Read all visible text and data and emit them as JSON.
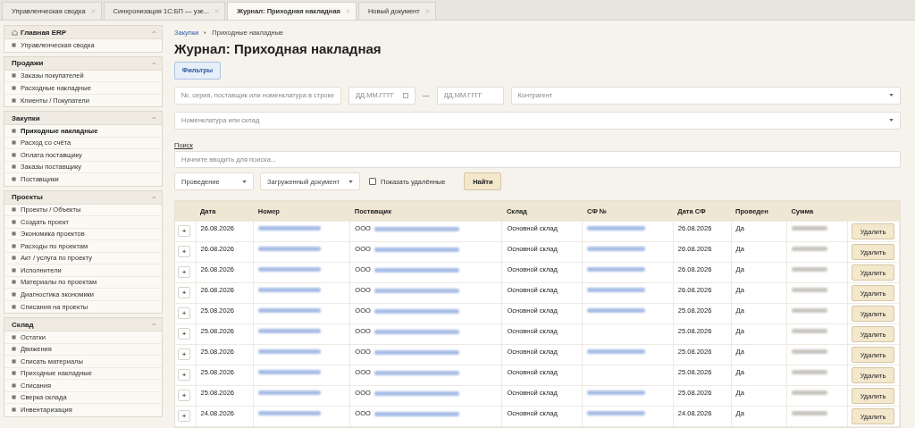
{
  "tabs": [
    {
      "label": "Управленческая сводка",
      "selected": false
    },
    {
      "label": "Синхронизация 1С:БП — узе...",
      "selected": false
    },
    {
      "label": "Журнал: Приходная накладная",
      "selected": true
    },
    {
      "label": "Новый документ",
      "selected": false
    }
  ],
  "sidebar": {
    "groups": [
      {
        "title": "Главная ERP",
        "expanded": true,
        "items": [
          {
            "label": "Управленческая сводка",
            "selected": false
          }
        ]
      },
      {
        "title": "Продажи",
        "expanded": true,
        "items": [
          {
            "label": "Заказы покупателей",
            "selected": false
          },
          {
            "label": "Расходные накладные",
            "selected": false
          },
          {
            "label": "Клиенты / Покупатели",
            "selected": false
          }
        ]
      },
      {
        "title": "Закупки",
        "expanded": true,
        "items": [
          {
            "label": "Приходные накладные",
            "selected": true
          },
          {
            "label": "Расход со счёта",
            "selected": false
          },
          {
            "label": "Оплата поставщику",
            "selected": false
          },
          {
            "label": "Заказы поставщику",
            "selected": false
          },
          {
            "label": "Поставщики",
            "selected": false
          }
        ]
      },
      {
        "title": "Проекты",
        "expanded": true,
        "items": [
          {
            "label": "Проекты / Объекты",
            "selected": false
          },
          {
            "label": "Создать проект",
            "selected": false
          },
          {
            "label": "Экономика проектов",
            "selected": false
          },
          {
            "label": "Расходы по проектам",
            "selected": false
          },
          {
            "label": "Акт / услуга по проекту",
            "selected": false
          },
          {
            "label": "Исполнители",
            "selected": false
          },
          {
            "label": "Материалы по проектам",
            "selected": false
          },
          {
            "label": "Диагностика экономики",
            "selected": false
          },
          {
            "label": "Списания на проекты",
            "selected": false
          }
        ]
      },
      {
        "title": "Склад",
        "expanded": true,
        "items": [
          {
            "label": "Остатки",
            "selected": false
          },
          {
            "label": "Движения",
            "selected": false
          },
          {
            "label": "Списать материалы",
            "selected": false
          },
          {
            "label": "Приходные накладные",
            "selected": false
          },
          {
            "label": "Списания",
            "selected": false
          },
          {
            "label": "Сверка склада",
            "selected": false
          },
          {
            "label": "Инвентаризация",
            "selected": false
          }
        ]
      }
    ]
  },
  "breadcrumb": [
    "Закупки",
    "Приходные накладные"
  ],
  "title": "Журнал: Приходная накладная",
  "filters_button": {
    "label": "Фильтры",
    "selected": true
  },
  "filters": {
    "doc_search": {
      "placeholder": "№, серия, поставщик или номенклатура в строке"
    },
    "date_from": {
      "placeholder": "ДД.ММ.ГГГГ"
    },
    "date_dash": "—",
    "date_to": {
      "placeholder": "ДД.ММ.ГГГГ"
    },
    "counterparty": {
      "placeholder": "Контрагент"
    },
    "nomenclature": {
      "placeholder": "Номенклатура или склад"
    },
    "search_label": "Поиск",
    "search": {
      "placeholder": "Начните вводить для поиска..."
    },
    "posting": {
      "value": "Проведение"
    },
    "loaded_document": {
      "value": "Загруженный документ"
    },
    "show_deleted": {
      "label": "Показать удалённые",
      "checked": false
    },
    "find_button": "Найти"
  },
  "table": {
    "columns": [
      "Дата",
      "Номер",
      "Поставщик",
      "Склад",
      "СФ №",
      "Дата СФ",
      "Проведен",
      "Сумма"
    ],
    "rows": [
      {
        "expand": "+",
        "date": "26.08.2026",
        "supplier_prefix": "ООО",
        "warehouse": "Основной склад",
        "has_invoice_number": true,
        "invoice_date": "26.08.2026",
        "posted": "Да",
        "action": "Удалить"
      },
      {
        "expand": "+",
        "date": "26.08.2026",
        "supplier_prefix": "ООО",
        "warehouse": "Основной склад",
        "has_invoice_number": true,
        "invoice_date": "26.08.2026",
        "posted": "Да",
        "action": "Удалить"
      },
      {
        "expand": "+",
        "date": "26.08.2026",
        "supplier_prefix": "ООО",
        "warehouse": "Основной склад",
        "has_invoice_number": true,
        "invoice_date": "26.08.2026",
        "posted": "Да",
        "action": "Удалить"
      },
      {
        "expand": "+",
        "date": "26.08.2026",
        "supplier_prefix": "ООО",
        "warehouse": "Основной склад",
        "has_invoice_number": true,
        "invoice_date": "26.08.2026",
        "posted": "Да",
        "action": "Удалить"
      },
      {
        "expand": "+",
        "date": "25.08.2026",
        "supplier_prefix": "ООО",
        "warehouse": "Основной склад",
        "has_invoice_number": true,
        "invoice_date": "25.08.2026",
        "posted": "Да",
        "action": "Удалить"
      },
      {
        "expand": "+",
        "date": "25.08.2026",
        "supplier_prefix": "ООО",
        "warehouse": "Основной склад",
        "has_invoice_number": false,
        "invoice_date": "25.08.2026",
        "posted": "Да",
        "action": "Удалить"
      },
      {
        "expand": "+",
        "date": "25.08.2026",
        "supplier_prefix": "ООО",
        "warehouse": "Основной склад",
        "has_invoice_number": true,
        "invoice_date": "25.08.2026",
        "posted": "Да",
        "action": "Удалить"
      },
      {
        "expand": "+",
        "date": "25.08.2026",
        "supplier_prefix": "ООО",
        "warehouse": "Основной склад",
        "has_invoice_number": false,
        "invoice_date": "25.08.2026",
        "posted": "Да",
        "action": "Удалить"
      },
      {
        "expand": "+",
        "date": "25.08.2026",
        "supplier_prefix": "ООО",
        "warehouse": "Основной склад",
        "has_invoice_number": true,
        "invoice_date": "25.08.2026",
        "posted": "Да",
        "action": "Удалить"
      },
      {
        "expand": "+",
        "date": "24.08.2026",
        "supplier_prefix": "ООО",
        "warehouse": "Основной склад",
        "has_invoice_number": true,
        "invoice_date": "24.08.2026",
        "posted": "Да",
        "action": "Удалить"
      }
    ]
  }
}
